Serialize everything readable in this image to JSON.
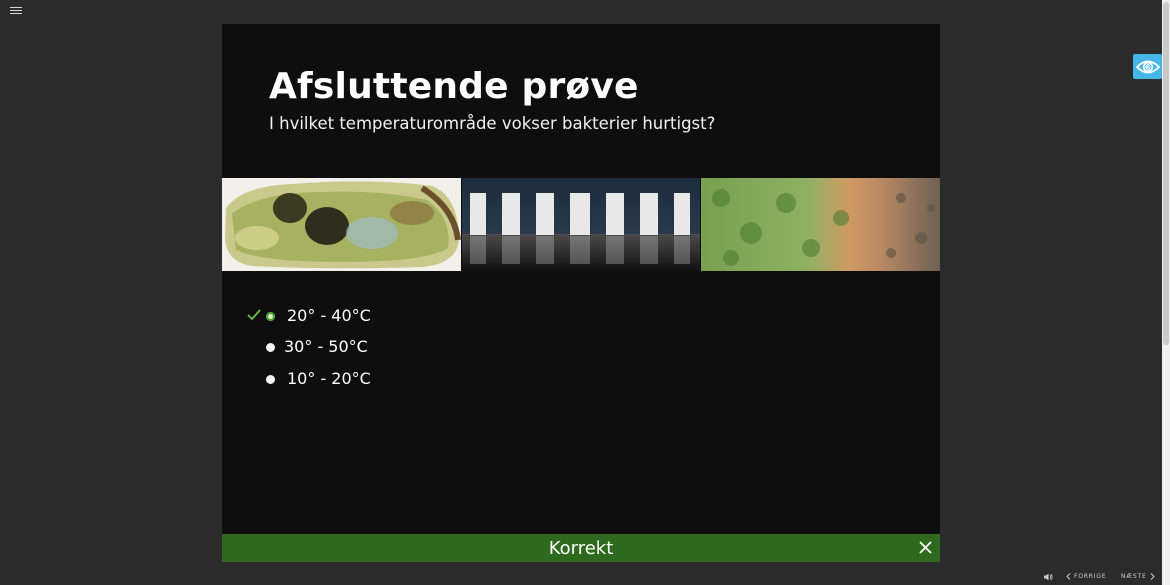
{
  "slide": {
    "title": "Afsluttende prøve",
    "question": "I hvilket temperaturområde vokser bakterier hurtigst?"
  },
  "images": [
    {
      "description": "mold-bread-image"
    },
    {
      "description": "doors-image"
    },
    {
      "description": "green-field-image"
    }
  ],
  "answers": [
    {
      "label": "20° - 40°C",
      "selected": true,
      "correct": true
    },
    {
      "label": "30° - 50°C",
      "selected": false
    },
    {
      "label": "10° - 20°C",
      "selected": false
    }
  ],
  "feedback": {
    "text": "Korrekt",
    "color": "#2e6a1e"
  },
  "nav": {
    "prev_label": "FORRIGE",
    "next_label": "NÆSTE"
  },
  "colors": {
    "background": "#2b2b2b",
    "slide": "#0e0e0e",
    "accessibility": "#45b6e6"
  }
}
